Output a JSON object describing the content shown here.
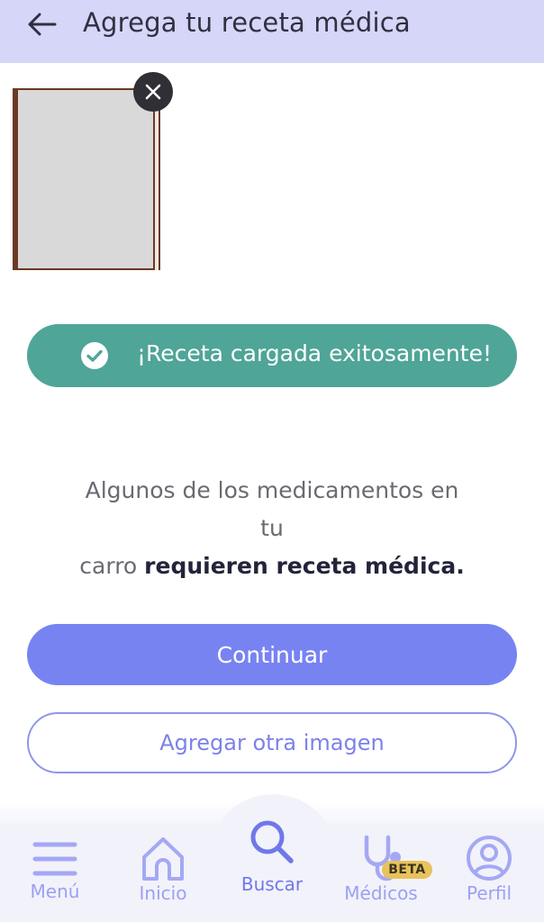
{
  "header": {
    "title": "Agrega tu receta médica",
    "back_icon": "arrow-left-icon"
  },
  "upload": {
    "thumbnail_alt": "receta",
    "remove_icon": "close-icon"
  },
  "toast": {
    "text": "¡Receta cargada exitosamente!",
    "icon": "check-circle-icon",
    "color": "#4fa597"
  },
  "notice": {
    "line1": "Algunos de los medicamentos en",
    "line2": "tu",
    "line3_plain": "carro ",
    "line3_bold": "requieren receta médica."
  },
  "actions": {
    "continue_label": "Continuar",
    "add_image_label": "Agregar otra imagen",
    "accent": "#7883f2"
  },
  "bottom_nav": {
    "items": [
      {
        "label": "Menú",
        "icon": "menu-icon"
      },
      {
        "label": "Inicio",
        "icon": "home-icon"
      },
      {
        "label": "Buscar",
        "icon": "search-icon",
        "active": true
      },
      {
        "label": "Médicos",
        "icon": "stethoscope-icon",
        "badge": "BETA"
      },
      {
        "label": "Perfil",
        "icon": "user-icon"
      }
    ]
  }
}
